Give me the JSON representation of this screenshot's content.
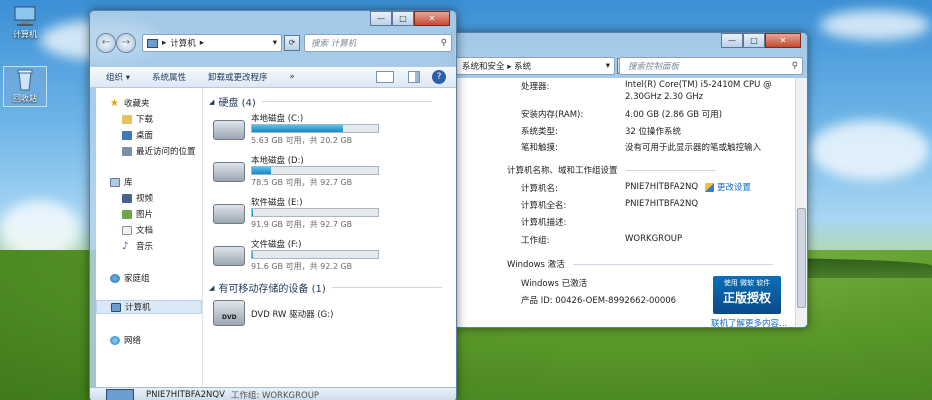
{
  "desktop": {
    "icons": [
      {
        "label": "计算机",
        "icon": "computer-icon"
      },
      {
        "label": "回收站",
        "icon": "recycle-bin-icon"
      }
    ]
  },
  "explorer": {
    "breadcrumb": [
      "计算机"
    ],
    "search_placeholder": "搜索 计算机",
    "toolbar": [
      "组织 ▾",
      "系统属性",
      "卸载或更改程序",
      "»"
    ],
    "nav": [
      {
        "label": "收藏夹",
        "level": 0,
        "icon": "star-icon"
      },
      {
        "label": "下载",
        "level": 1,
        "icon": "folder-icon"
      },
      {
        "label": "桌面",
        "level": 1,
        "icon": "desktop-icon"
      },
      {
        "label": "最近访问的位置",
        "level": 1,
        "icon": "recent-icon"
      },
      {
        "label": "库",
        "level": 0,
        "icon": "library-icon"
      },
      {
        "label": "视频",
        "level": 1,
        "icon": "video-icon"
      },
      {
        "label": "图片",
        "level": 1,
        "icon": "picture-icon"
      },
      {
        "label": "文档",
        "level": 1,
        "icon": "document-icon"
      },
      {
        "label": "音乐",
        "level": 1,
        "icon": "music-icon"
      },
      {
        "label": "家庭组",
        "level": 0,
        "icon": "homegroup-icon"
      },
      {
        "label": "计算机",
        "level": 0,
        "icon": "computer-icon"
      },
      {
        "label": "网络",
        "level": 0,
        "icon": "network-icon"
      }
    ],
    "hdd_header": "硬盘 (4)",
    "drives": [
      {
        "name": "本地磁盘 (C:)",
        "free": "5.63 GB 可用，共 20.2 GB",
        "used_fraction": 0.72
      },
      {
        "name": "本地磁盘 (D:)",
        "free": "78.5 GB 可用，共 92.7 GB",
        "used_fraction": 0.15
      },
      {
        "name": "软件磁盘 (E:)",
        "free": "91.9 GB 可用，共 92.7 GB",
        "used_fraction": 0.01
      },
      {
        "name": "文件磁盘 (F:)",
        "free": "91.6 GB 可用，共 92.2 GB",
        "used_fraction": 0.01
      }
    ],
    "removable_header": "有可移动存储的设备 (1)",
    "removable": {
      "name": "DVD RW 驱动器 (G:)",
      "badge": "DVD"
    },
    "status": {
      "name": "PNIE7HITBFA2NQV",
      "detail": "工作组: WORKGROUP"
    },
    "caption": {
      "min": "—",
      "max": "□",
      "close": "✕"
    }
  },
  "system": {
    "breadcrumb": "系统和安全 ▸ 系统",
    "prefix": "▸",
    "search_placeholder": "搜索控制面板",
    "rows": [
      {
        "k": "处理器:",
        "v": "Intel(R) Core(TM) i5-2410M CPU @"
      },
      {
        "k": "",
        "v": "2.30GHz   2.30 GHz"
      },
      {
        "k": "安装内存(RAM):",
        "v": "4.00 GB (2.86 GB 可用)"
      },
      {
        "k": "系统类型:",
        "v": "32 位操作系统"
      },
      {
        "k": "笔和触摸:",
        "v": "没有可用于此显示器的笔或触控输入"
      }
    ],
    "section_name": "计算机名称、域和工作组设置",
    "name_rows": [
      {
        "k": "计算机名:",
        "v": "PNIE7HITBFA2NQ"
      },
      {
        "k": "计算机全名:",
        "v": "PNIE7HITBFA2NQ"
      },
      {
        "k": "计算机描述:",
        "v": ""
      },
      {
        "k": "工作组:",
        "v": "WORKGROUP"
      }
    ],
    "change_settings": "更改设置",
    "section_activation": "Windows 激活",
    "activated": "Windows 已激活",
    "product_id": "产品 ID: 00426-OEM-8992662-00006",
    "genuine_top": "使用 微软 软件",
    "genuine_main": "正版授权",
    "learn_more": "联机了解更多内容...",
    "caption": {
      "min": "—",
      "max": "□",
      "close": "✕"
    }
  }
}
